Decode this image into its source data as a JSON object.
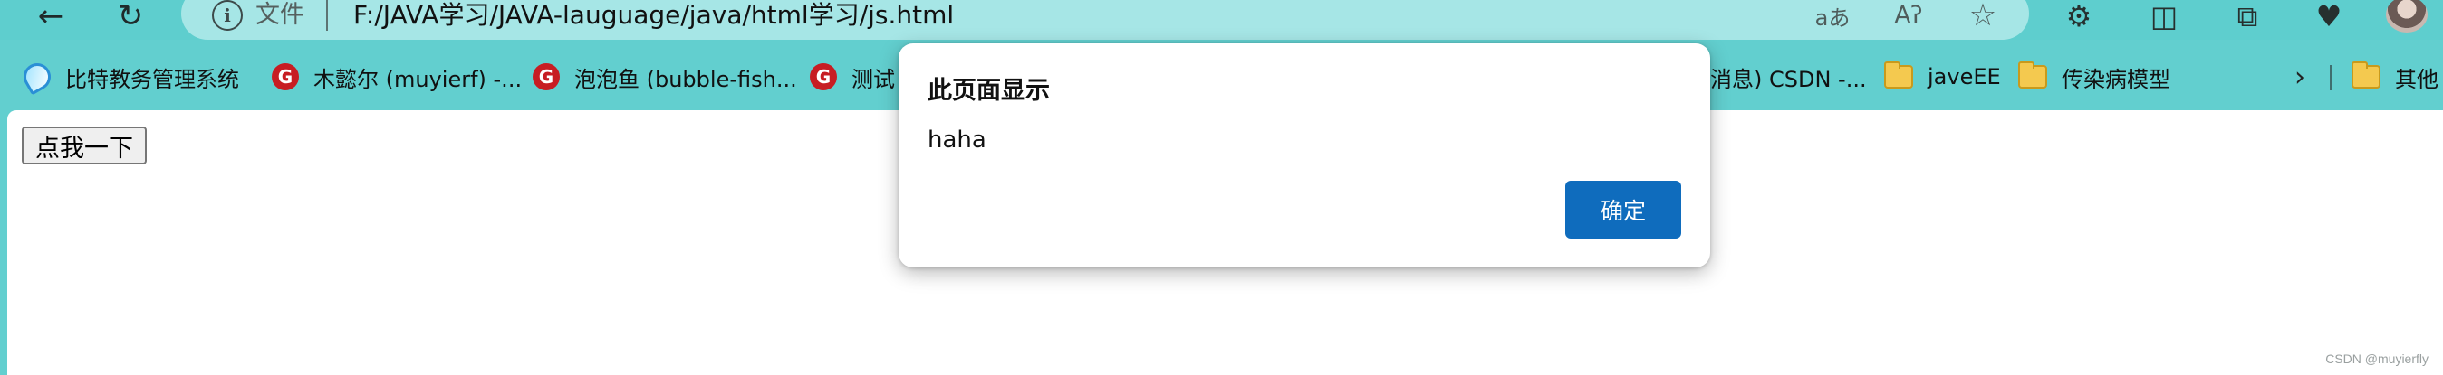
{
  "browser": {
    "address": {
      "scheme_label": "文件",
      "url": "F:/JAVA学习/JAVA-lauguage/java/html学习/js.html",
      "info_icon": "info-icon",
      "read_aloud_glyph": "Aʔ",
      "translate_glyph": "aあ"
    },
    "nav": {
      "back_icon": "←",
      "refresh_icon": "↻"
    },
    "toolbar": {
      "extensions_icon": "⚙",
      "split_icon": "◫",
      "collections_icon": "⧉",
      "performance_icon": "♥"
    }
  },
  "bookmarks": [
    {
      "label": "比特教务管理系统",
      "icon": "swirl-icon"
    },
    {
      "label": "木懿尔 (muyierf) -...",
      "icon": "gitee-icon"
    },
    {
      "label": "泡泡鱼 (bubble-fish...",
      "icon": "gitee-icon"
    },
    {
      "label": "测试",
      "icon": "gitee-icon"
    },
    {
      "label": "javeEE",
      "icon": "folder-icon"
    },
    {
      "label": "传染病模型",
      "icon": "folder-icon"
    },
    {
      "label": "其他",
      "icon": "folder-icon"
    }
  ],
  "bookmark_partial": "消息) CSDN -...",
  "bookmarks_more": "›",
  "page": {
    "button_label": "点我一下",
    "watermark": "CSDN @muyierfly"
  },
  "dialog": {
    "title": "此页面显示",
    "message": "haha",
    "ok_label": "确定"
  },
  "colors": {
    "frame": "#62cfcf",
    "address_bar": "#a6e6e6",
    "dialog_button": "#0f6cbd"
  }
}
